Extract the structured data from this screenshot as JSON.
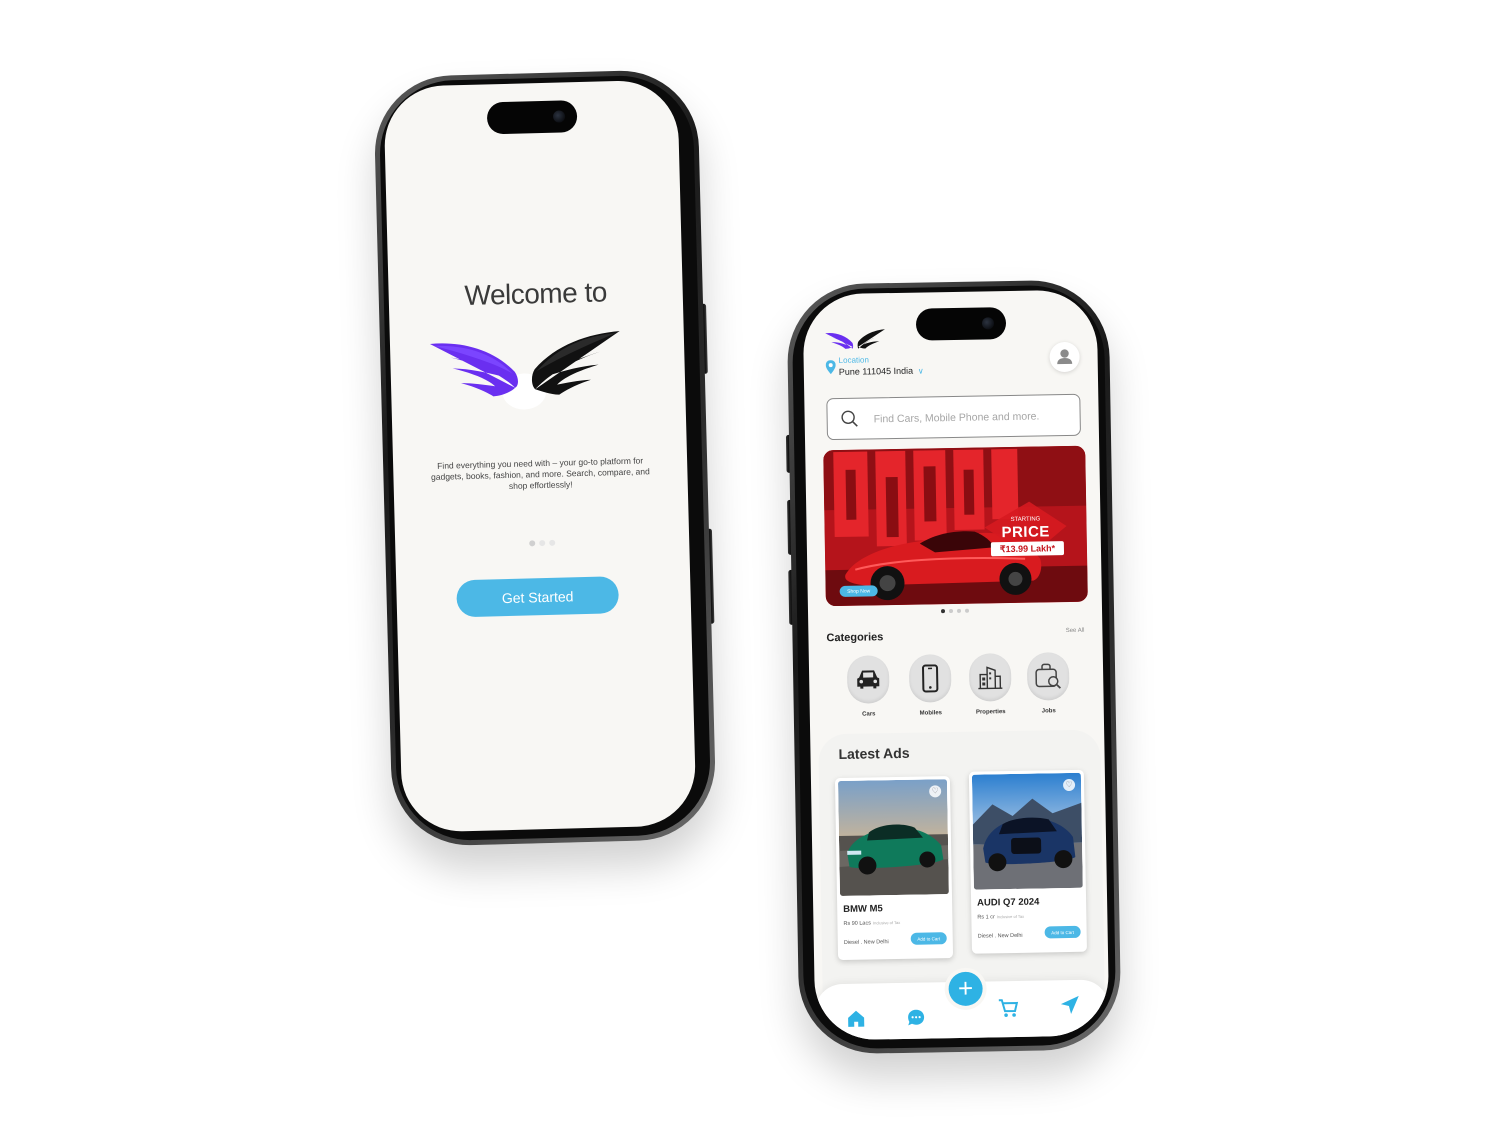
{
  "welcome_screen": {
    "title": "Welcome to",
    "description": "Find everything you need with – your go-to platform for gadgets, books, fashion, and more. Search, compare, and shop effortlessly!",
    "pager": {
      "total": 3,
      "active": 1
    },
    "cta_label": "Get Started",
    "colors": {
      "accent": "#4cb8e6",
      "logo_purple": "#6a2ff0",
      "logo_black": "#111111"
    }
  },
  "home_screen": {
    "location": {
      "label": "Location",
      "value": "Pune 111045 India"
    },
    "search": {
      "placeholder": "Find Cars, Mobile Phone and more."
    },
    "banner": {
      "starting_label": "STARTING",
      "price_label": "PRICE",
      "price_value": "₹13.99 Lakh*",
      "button_label": "Shop Now",
      "pager": {
        "total": 4,
        "active": 1
      }
    },
    "categories": {
      "title": "Categories",
      "see_all": "See All",
      "items": [
        {
          "label": "Cars",
          "icon": "car-icon"
        },
        {
          "label": "Mobiles",
          "icon": "mobile-phone-icon"
        },
        {
          "label": "Properties",
          "icon": "building-icon"
        },
        {
          "label": "Jobs",
          "icon": "job-search-icon"
        }
      ]
    },
    "latest_ads": {
      "title": "Latest Ads",
      "items": [
        {
          "name": "BMW M5",
          "price": "Rs 90 Lacs",
          "price_note": "Inclusive of Tax",
          "meta": "Diesel . New Delhi",
          "button": "Add to Cart"
        },
        {
          "name": "AUDI Q7 2024",
          "price": "Rs 1 cr",
          "price_note": "Inclusive of Tax",
          "meta": "Diesel . New Delhi",
          "button": "Add to Cart"
        }
      ]
    },
    "bottom_nav": {
      "items": [
        "home-icon",
        "chat-icon",
        "add-icon",
        "cart-icon",
        "send-icon"
      ],
      "fab_symbol": "+"
    },
    "colors": {
      "accent": "#4cb8e6",
      "banner_red": "#c4151d"
    }
  }
}
